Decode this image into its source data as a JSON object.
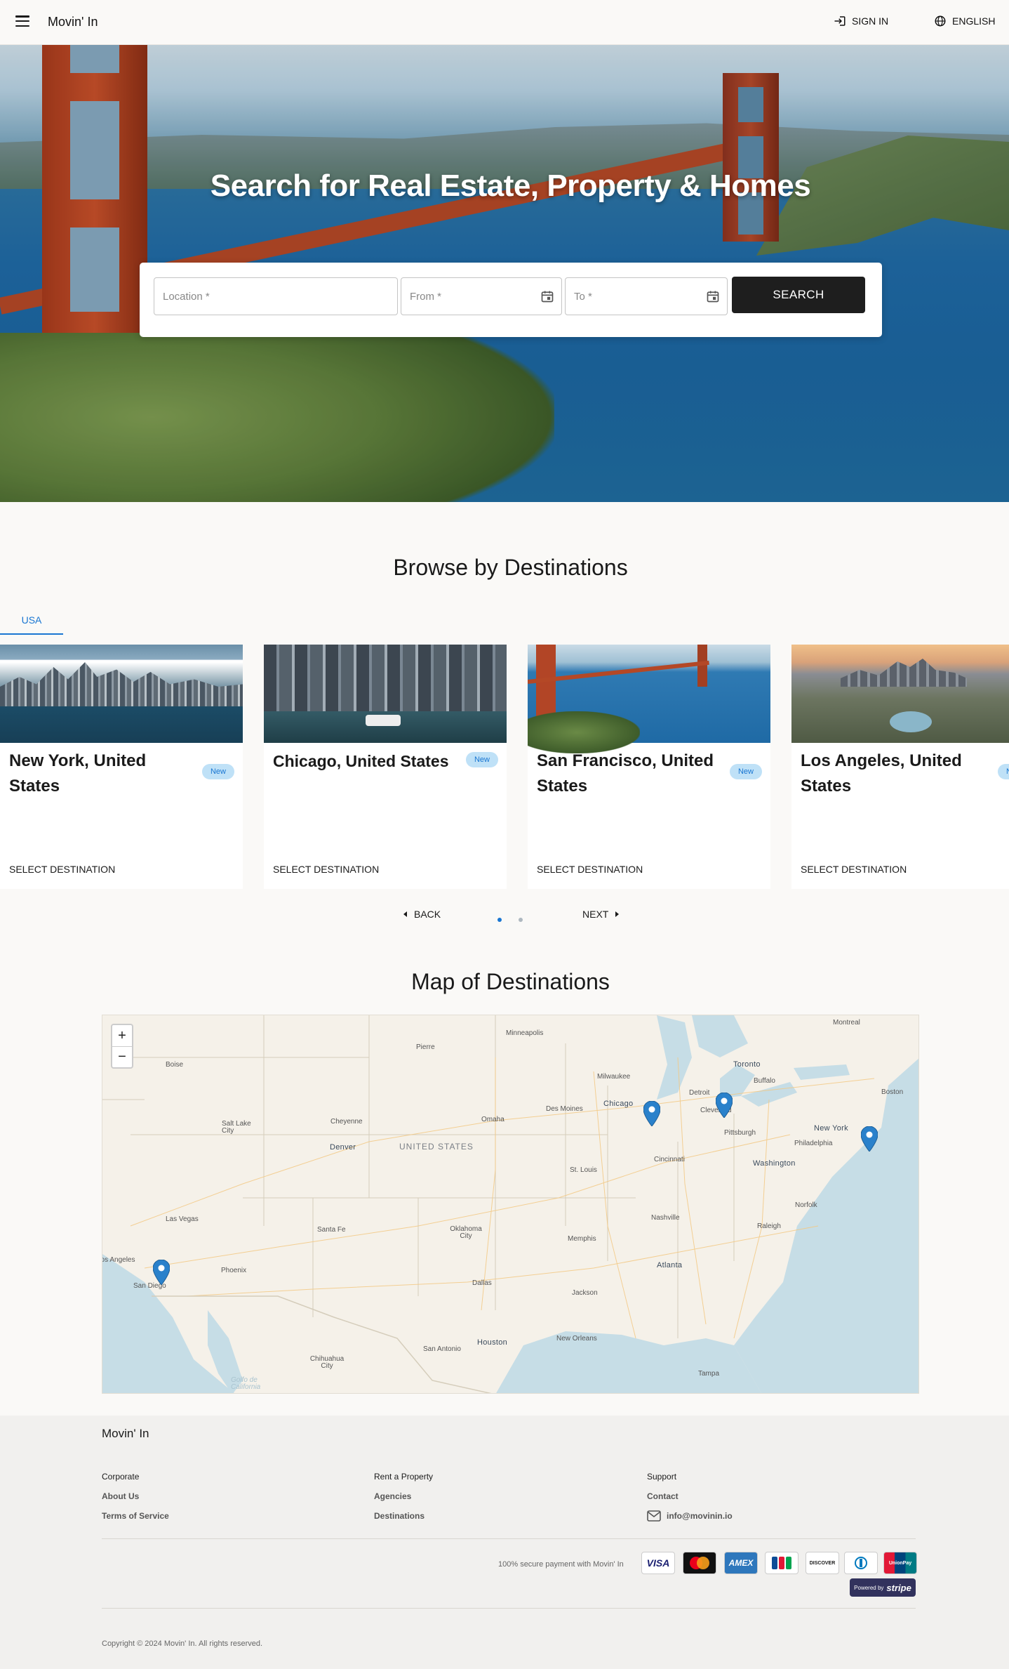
{
  "header": {
    "brand": "Movin' In",
    "sign_in": "SIGN IN",
    "language": "ENGLISH"
  },
  "hero": {
    "title": "Search for Real Estate, Property & Homes",
    "location_placeholder": "Location *",
    "from_placeholder": "From *",
    "to_placeholder": "To *",
    "search_label": "SEARCH"
  },
  "browse": {
    "title": "Browse by Destinations",
    "tab": "USA",
    "cards": [
      {
        "name": "New York, United States",
        "badge": "New",
        "action": "SELECT DESTINATION"
      },
      {
        "name": "Chicago, United States",
        "badge": "New",
        "action": "SELECT DESTINATION"
      },
      {
        "name": "San Francisco, United States",
        "badge": "New",
        "action": "SELECT DESTINATION"
      },
      {
        "name": "Los Angeles, United States",
        "badge": "New",
        "action": "SELECT DESTINATION"
      }
    ],
    "back": "BACK",
    "next": "NEXT",
    "page_dots": 2,
    "active_dot": 1
  },
  "map": {
    "title": "Map of Destinations",
    "zoom_in": "+",
    "zoom_out": "−",
    "country_label": "UNITED STATES",
    "cities": [
      "Minneapolis",
      "Montreal",
      "Boise",
      "Pierre",
      "Toronto",
      "Buffalo",
      "Milwaukee",
      "Detroit",
      "Boston",
      "Salt Lake City",
      "Cheyenne",
      "Omaha",
      "Des Moines",
      "Chicago",
      "Cleveland",
      "New York",
      "Denver",
      "Pittsburgh",
      "Philadelphia",
      "Cincinnati",
      "Washington",
      "St. Louis",
      "Norfolk",
      "Las Vegas",
      "Nashville",
      "Santa Fe",
      "Oklahoma City",
      "Raleigh",
      "Memphis",
      "Los Angeles",
      "Phoenix",
      "Atlanta",
      "San Diego",
      "Dallas",
      "Jackson",
      "New Orleans",
      "Houston",
      "San Antonio",
      "Chihuahua City",
      "Tampa",
      "Golfo de California"
    ]
  },
  "footer": {
    "brand": "Movin' In",
    "col1": {
      "heading": "Corporate",
      "links": [
        "About Us",
        "Terms of Service"
      ]
    },
    "col2": {
      "heading": "Rent a Property",
      "links": [
        "Agencies",
        "Destinations"
      ]
    },
    "col3": {
      "heading": "Support",
      "links": [
        "Contact"
      ],
      "email": "info@movinin.io"
    },
    "secure_text": "100% secure payment with Movin' In",
    "payment_methods": [
      "VISA",
      "Mastercard",
      "AMEX",
      "JCB",
      "DISCOVER",
      "Diners Club",
      "UnionPay"
    ],
    "stripe_prefix": "Powered by",
    "stripe_brand": "stripe",
    "copyright": "Copyright © 2024 Movin' In. All rights reserved."
  },
  "colors": {
    "accent": "#1976d2",
    "badge_bg": "#bfe1f7",
    "search_button": "#1e1e1e",
    "marker": "#2a81cb"
  }
}
